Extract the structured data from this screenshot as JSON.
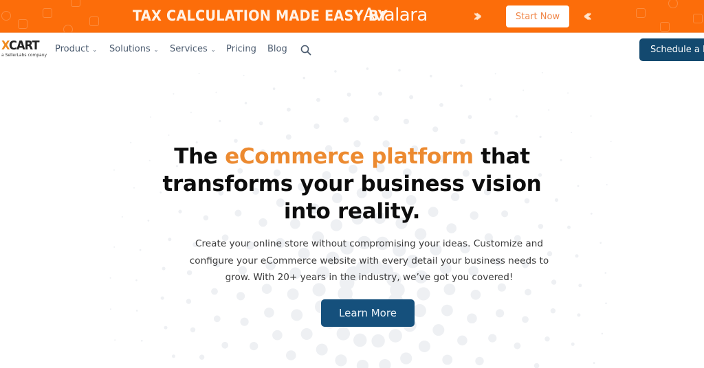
{
  "promo_banner": {
    "headline": "TAX CALCULATION MADE EASY BY",
    "brand": "Avalara",
    "cta_label": "Start Now",
    "bg_color": "#fc6d0a"
  },
  "nav": {
    "logo": {
      "main_prefix": "X",
      "main_rest": "CART",
      "tagline": "a SellerLabs company"
    },
    "items": [
      {
        "label": "Product",
        "has_dropdown": true
      },
      {
        "label": "Solutions",
        "has_dropdown": true
      },
      {
        "label": "Services",
        "has_dropdown": true
      },
      {
        "label": "Pricing",
        "has_dropdown": false
      },
      {
        "label": "Blog",
        "has_dropdown": false
      }
    ],
    "search_icon": "search-icon",
    "cta_label": "Schedule a Demo",
    "cta_color": "#13496f"
  },
  "hero": {
    "title_before": "The ",
    "title_accent": "eCommerce platform",
    "title_after": " that transforms your business vision into reality.",
    "accent_color": "#ec8a30",
    "description": "Create your online store without compromising your ideas. Customize and configure your eCommerce website with every detail your business needs to grow. With 20+ years in the industry, we’ve got you covered!",
    "cta_label": "Learn More",
    "cta_color": "#15507c"
  }
}
